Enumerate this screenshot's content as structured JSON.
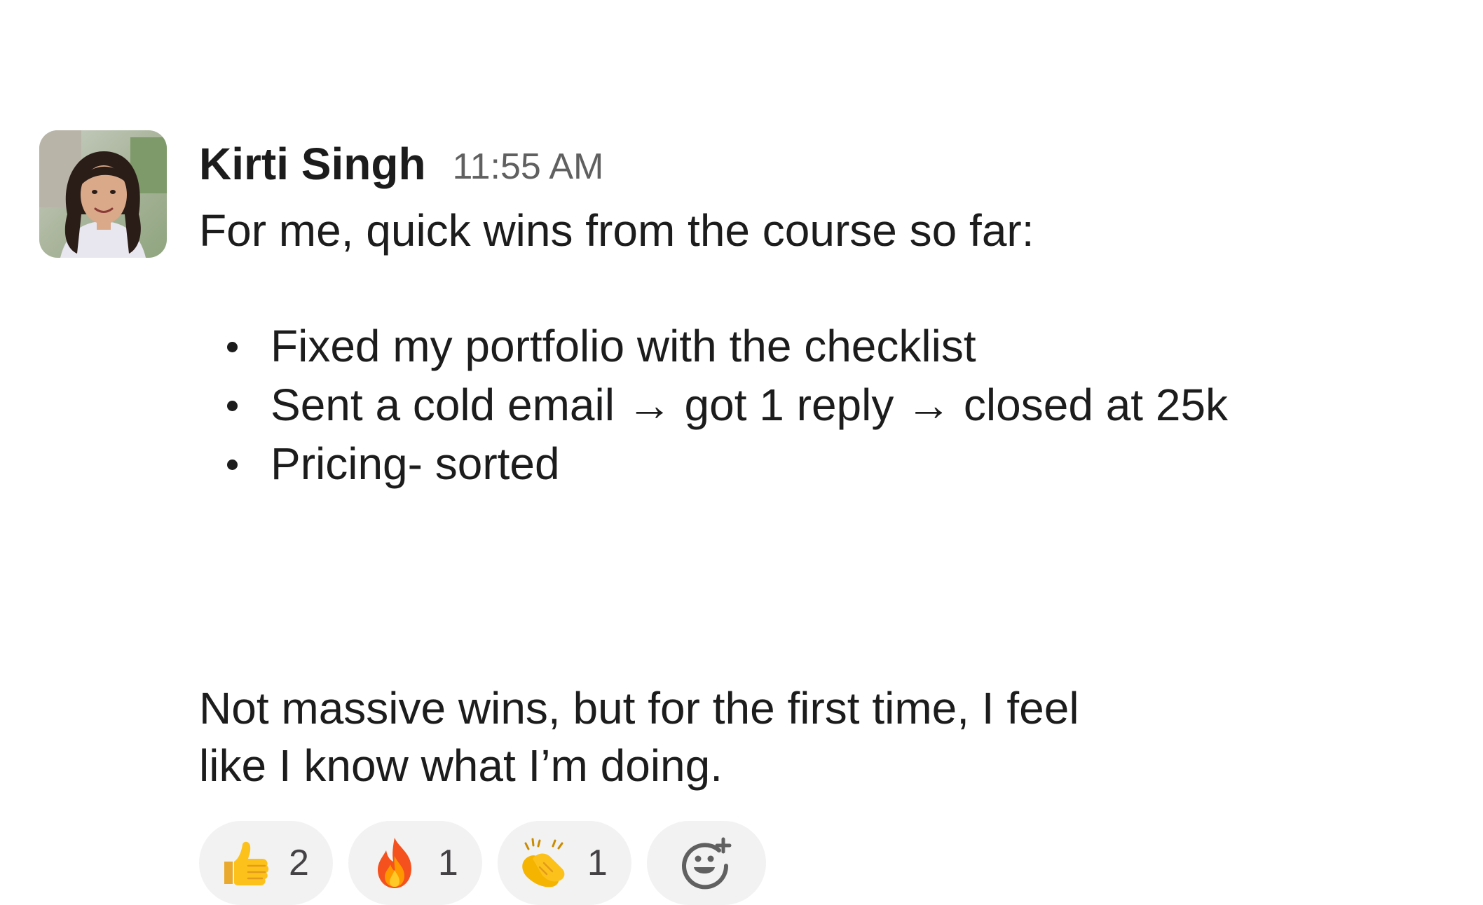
{
  "message": {
    "author": "Kirti Singh",
    "timestamp": "11:55 AM",
    "intro": "For me, quick wins from the course so far:",
    "bullets": [
      "Fixed my portfolio with the checklist",
      "Sent a cold email → got 1 reply → closed at 25k",
      "Pricing- sorted"
    ],
    "outro_line1": "Not massive wins, but for the first time, I feel",
    "outro_line2": "like I know what I’m doing."
  },
  "reactions": [
    {
      "emoji": "thumbs-up",
      "count": "2"
    },
    {
      "emoji": "fire",
      "count": "1"
    },
    {
      "emoji": "clapping-hands",
      "count": "1"
    }
  ],
  "add_reaction_icon": "add-reaction-icon",
  "colors": {
    "text": "#1d1c1d",
    "timestamp": "#616061",
    "pill_background": "#f2f2f2"
  }
}
